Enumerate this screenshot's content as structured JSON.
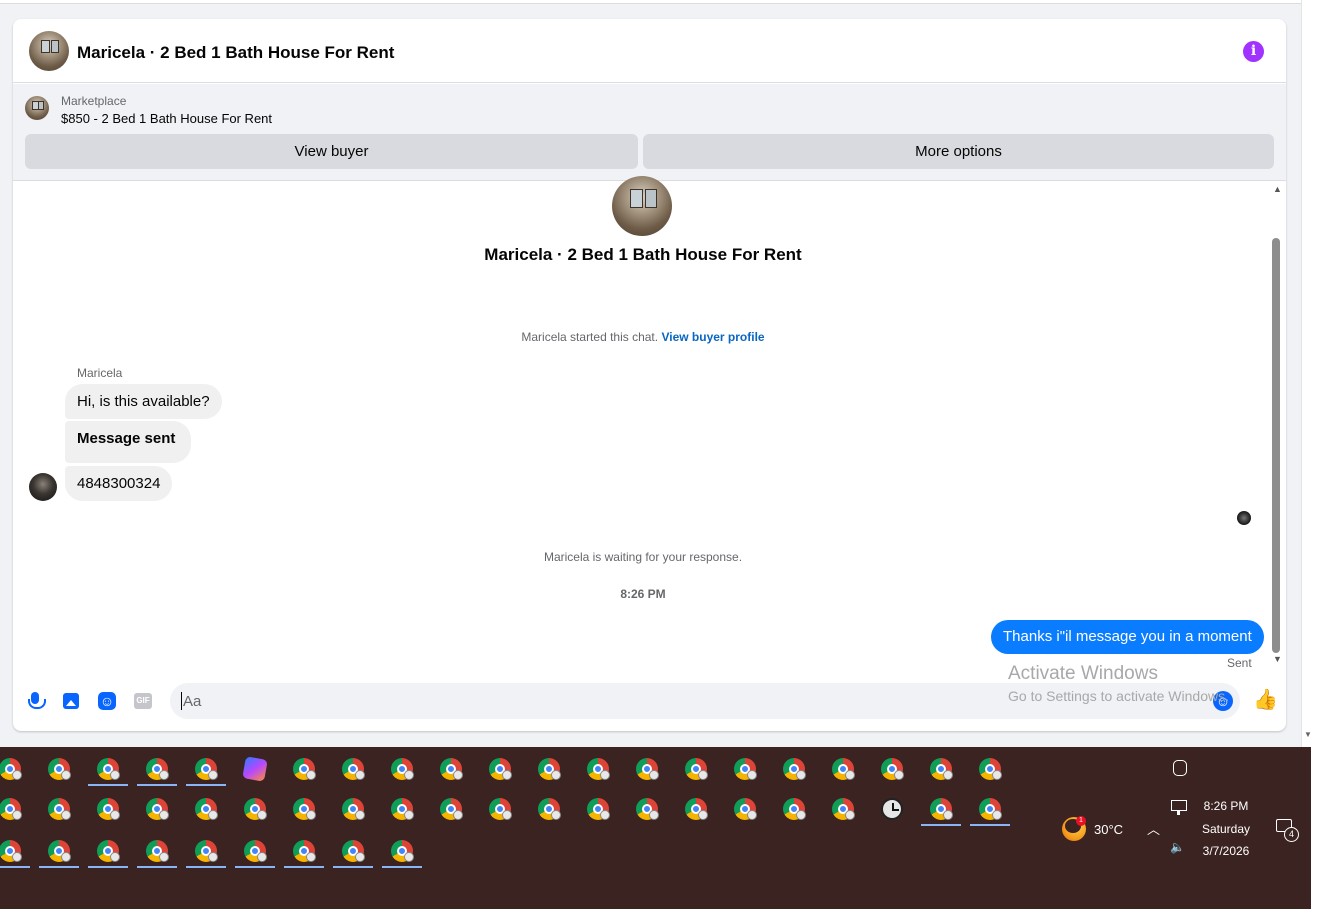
{
  "header": {
    "title": "Maricela · 2 Bed 1 Bath House For Rent"
  },
  "marketplace": {
    "label": "Marketplace",
    "listing": "$850 - 2 Bed 1 Bath House For Rent",
    "view_buyer_label": "View buyer",
    "more_options_label": "More options"
  },
  "chat": {
    "title": "Maricela · 2 Bed 1 Bath House For Rent",
    "started_text": "Maricela started this chat.",
    "view_profile_link": "View buyer profile",
    "sender_name": "Maricela",
    "messages_in": [
      "Hi, is this available?",
      "Message sent",
      "4848300324"
    ],
    "waiting_text": "Maricela is waiting for your response.",
    "timestamp": "8:26 PM",
    "message_out": "Thanks i\"il message you in a moment",
    "sent_status": "Sent"
  },
  "composer": {
    "placeholder": "Aa",
    "gif_label": "GIF"
  },
  "watermark": {
    "title": "Activate Windows",
    "subtitle": "Go to Settings to activate Windows."
  },
  "taskbar": {
    "temperature": "30°C",
    "weather_badge": "1",
    "time": "8:26 PM",
    "day": "Saturday",
    "date": "3/7/2026",
    "notification_count": "4"
  },
  "colors": {
    "accent": "#0866ff",
    "outgoing_bubble": "#0a7cff",
    "info_icon": "#a033ff",
    "taskbar_bg": "#3a2320"
  }
}
